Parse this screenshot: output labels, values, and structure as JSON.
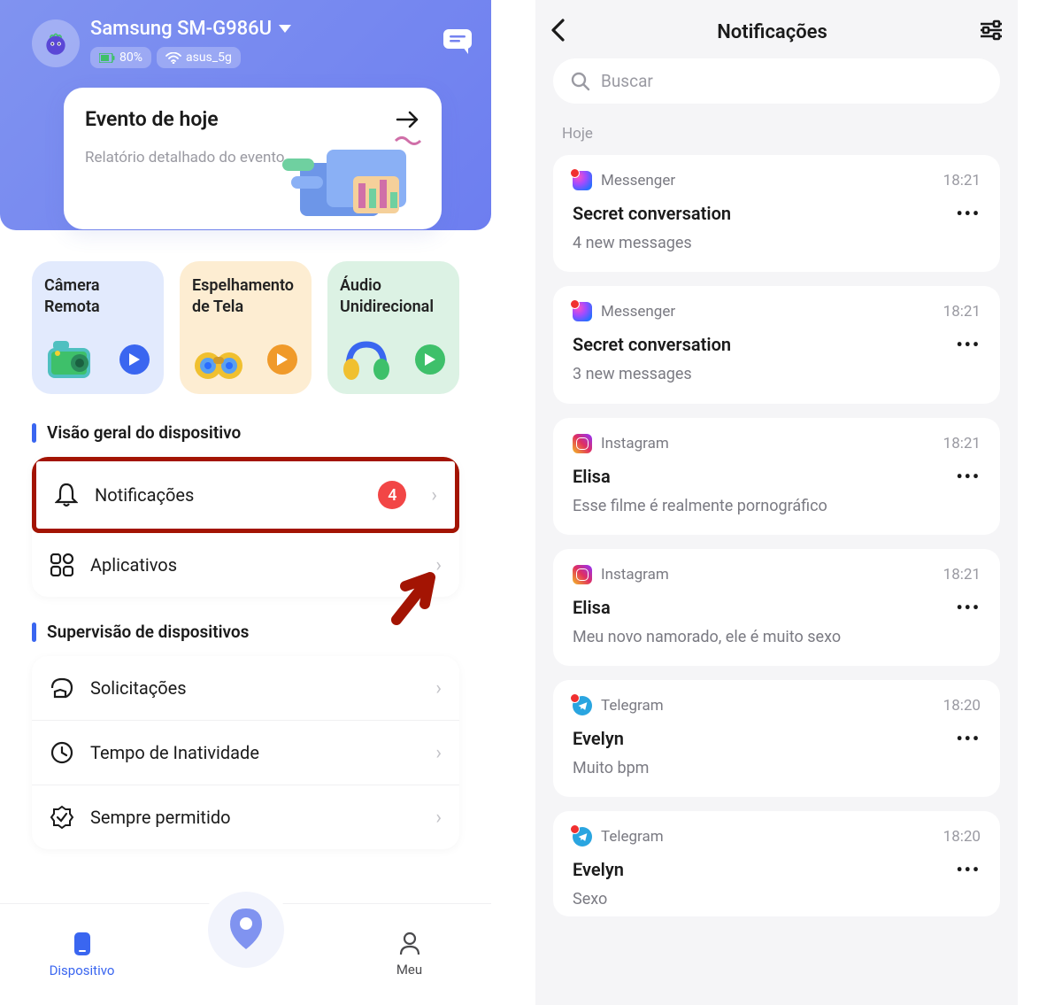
{
  "left": {
    "header": {
      "device_name": "Samsung SM-G986U",
      "battery": "80%",
      "wifi": "asus_5g"
    },
    "event": {
      "title": "Evento de hoje",
      "subtitle": "Relatório detalhado do evento"
    },
    "quick": [
      {
        "label": "Câmera Remota"
      },
      {
        "label": "Espelhamento de Tela"
      },
      {
        "label": "Áudio Unidirecional"
      }
    ],
    "sections": {
      "overview": "Visão geral do dispositivo",
      "supervision": "Supervisão de dispositivos"
    },
    "overview_items": {
      "notifications": {
        "label": "Notificações",
        "badge": "4"
      },
      "apps": {
        "label": "Aplicativos"
      }
    },
    "supervision_items": {
      "requests": {
        "label": "Solicitações"
      },
      "downtime": {
        "label": "Tempo de Inatividade"
      },
      "always_allowed": {
        "label": "Sempre permitido"
      }
    },
    "tabs": {
      "device": "Dispositivo",
      "me": "Meu"
    }
  },
  "right": {
    "title": "Notificações",
    "search_placeholder": "Buscar",
    "section_today": "Hoje",
    "notifications": [
      {
        "app": "Messenger",
        "time": "18:21",
        "title": "Secret conversation",
        "subtitle": "4 new messages",
        "icon": "messenger"
      },
      {
        "app": "Messenger",
        "time": "18:21",
        "title": "Secret conversation",
        "subtitle": "3 new messages",
        "icon": "messenger"
      },
      {
        "app": "Instagram",
        "time": "18:21",
        "title": "Elisa",
        "subtitle": "Esse filme é realmente pornográfico",
        "icon": "instagram"
      },
      {
        "app": "Instagram",
        "time": "18:21",
        "title": "Elisa",
        "subtitle": "Meu novo namorado, ele é muito sexo",
        "icon": "instagram"
      },
      {
        "app": "Telegram",
        "time": "18:20",
        "title": "Evelyn",
        "subtitle": "Muito bpm",
        "icon": "telegram"
      },
      {
        "app": "Telegram",
        "time": "18:20",
        "title": "Evelyn",
        "subtitle": "Sexo",
        "icon": "telegram"
      }
    ]
  }
}
